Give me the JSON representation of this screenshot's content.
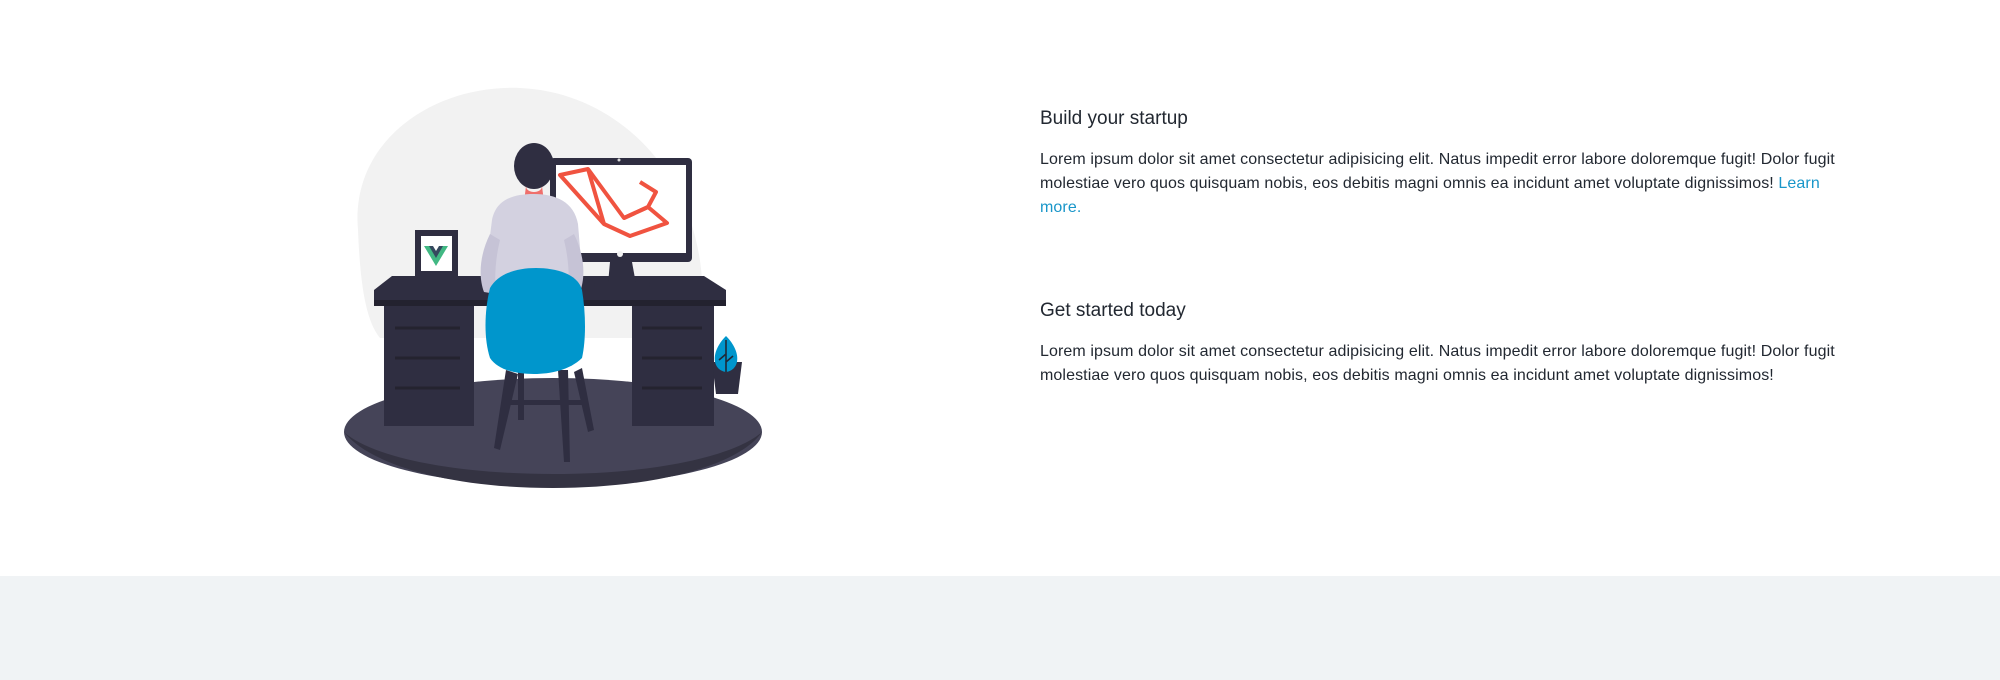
{
  "features": [
    {
      "title": "Build your startup",
      "text": "Lorem ipsum dolor sit amet consectetur adipisicing elit. Natus impedit error labore doloremque fugit! Dolor fugit molestiae vero quos quisquam nobis, eos debitis magni omnis ea incidunt amet voluptate dignissimos!",
      "link_text": "Learn more."
    },
    {
      "title": "Get started today",
      "text": "Lorem ipsum dolor sit amet consectetur adipisicing elit. Natus impedit error labore doloremque fugit! Dolor fugit molestiae vero quos quisquam nobis, eos debitis magni omnis ea incidunt amet voluptate dignissimos!"
    }
  ],
  "illustration": {
    "icons": [
      "vue-logo-icon",
      "laravel-logo-icon",
      "plant-icon"
    ],
    "colors": {
      "blob": "#f2f2f2",
      "desk": "#2f2e41",
      "chair": "#0096cc",
      "shirt": "#d3d1e0",
      "laravel": "#f05340",
      "vue_green": "#41b883",
      "vue_dark": "#35495e"
    }
  },
  "colors": {
    "link": "#1996c9",
    "footer_background": "#f0f3f5"
  }
}
